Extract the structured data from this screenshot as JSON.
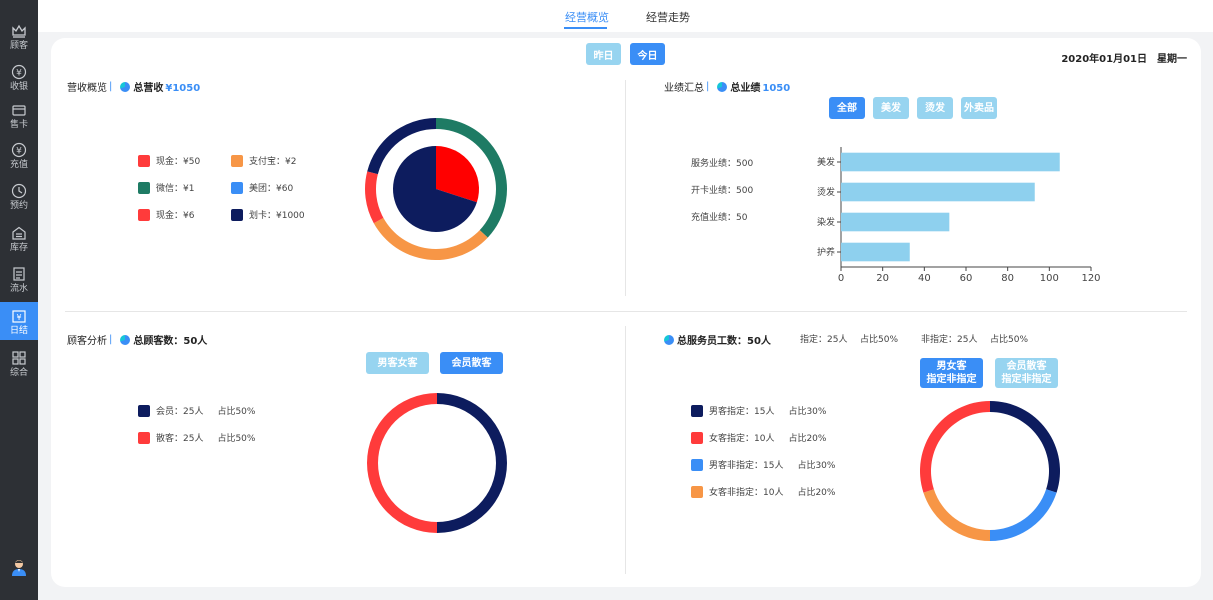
{
  "sidebar": {
    "items": [
      {
        "label": "顾客",
        "icon": "crown-icon"
      },
      {
        "label": "收银",
        "icon": "yen-circle-icon"
      },
      {
        "label": "售卡",
        "icon": "card-icon"
      },
      {
        "label": "充值",
        "icon": "yen-circle-icon"
      },
      {
        "label": "预约",
        "icon": "clock-icon"
      },
      {
        "label": "库存",
        "icon": "warehouse-icon"
      },
      {
        "label": "流水",
        "icon": "list-icon"
      },
      {
        "label": "日结",
        "icon": "calendar-yen-icon"
      },
      {
        "label": "综合",
        "icon": "grid-icon"
      }
    ],
    "active": "日结"
  },
  "tabs": {
    "overview": "经营概览",
    "trend": "经营走势",
    "active": "经营概览"
  },
  "day_buttons": {
    "yesterday": "昨日",
    "today": "今日"
  },
  "date": {
    "date": "2020年01月01日",
    "weekday": "星期一"
  },
  "revenue": {
    "title": "营收概览",
    "sep": "|",
    "total_label": "总营收",
    "total_value": "¥1050",
    "legend": [
      {
        "label": "现金：¥50",
        "color": "#ff3b3b"
      },
      {
        "label": "支付宝：¥2",
        "color": "#f79646"
      },
      {
        "label": "微信：¥1",
        "color": "#1e7b64"
      },
      {
        "label": "美团：¥60",
        "color": "#3a8ef6"
      },
      {
        "label": "现金：¥6",
        "color": "#ff3b3b"
      },
      {
        "label": "划卡：¥1000",
        "color": "#0d1c5e"
      }
    ]
  },
  "performance": {
    "title": "业绩汇总",
    "sep": "|",
    "total_label": "总业绩",
    "total_value": "1050",
    "filters": [
      "全部",
      "美发",
      "烫发",
      "外卖品"
    ],
    "stats": [
      "服务业绩：500",
      "开卡业绩：500",
      "充值业绩：50"
    ]
  },
  "customers": {
    "title": "顾客分析",
    "sep": "|",
    "total_label": "总顾客数：",
    "total_value": "50人",
    "toggle": [
      "男客女客",
      "会员散客"
    ],
    "legend": [
      {
        "label": "会员：25人",
        "pct": "占比50%",
        "color": "#0d1c5e"
      },
      {
        "label": "散客：25人",
        "pct": "占比50%",
        "color": "#ff3b3b"
      }
    ]
  },
  "staff": {
    "total_label": "总服务员工数：",
    "total_value": "50人",
    "designated": "指定：25人",
    "designated_pct": "占比50%",
    "non_designated": "非指定：25人",
    "non_designated_pct": "占比50%",
    "toggle": [
      {
        "line1": "男女客",
        "line2": "指定非指定"
      },
      {
        "line1": "会员散客",
        "line2": "指定非指定"
      }
    ],
    "legend": [
      {
        "label": "男客指定：15人",
        "pct": "占比30%",
        "color": "#0d1c5e"
      },
      {
        "label": "女客指定：10人",
        "pct": "占比20%",
        "color": "#ff3b3b"
      },
      {
        "label": "男客非指定：15人",
        "pct": "占比30%",
        "color": "#3a8ef6"
      },
      {
        "label": "女客非指定：10人",
        "pct": "占比20%",
        "color": "#f79646"
      }
    ]
  },
  "chart_data": [
    {
      "type": "pie",
      "name": "revenue-inner",
      "labels": [
        "现金",
        "划卡"
      ],
      "values": [
        30,
        70
      ],
      "colors": [
        "#ff0000",
        "#0d1c5e"
      ]
    },
    {
      "type": "pie",
      "name": "revenue-ring",
      "labels": [
        "segment-1",
        "segment-2",
        "segment-3",
        "segment-4"
      ],
      "values": [
        37,
        30,
        12,
        21
      ],
      "colors": [
        "#1e7b64",
        "#f79646",
        "#ff3b3b",
        "#0d1c5e"
      ]
    },
    {
      "type": "bar",
      "orientation": "horizontal",
      "categories": [
        "美发",
        "烫发",
        "染发",
        "护养"
      ],
      "values": [
        105,
        93,
        52,
        33
      ],
      "xlim": [
        0,
        120
      ],
      "xticks": [
        0,
        20,
        40,
        60,
        80,
        100,
        120
      ],
      "color": "#8ed0ee"
    },
    {
      "type": "pie",
      "name": "customers",
      "labels": [
        "会员",
        "散客"
      ],
      "values": [
        50,
        50
      ],
      "colors": [
        "#0d1c5e",
        "#ff3b3b"
      ]
    },
    {
      "type": "pie",
      "name": "staff",
      "labels": [
        "男客指定",
        "男客非指定",
        "女客非指定",
        "女客指定"
      ],
      "values": [
        30,
        20,
        20,
        30
      ],
      "colors": [
        "#0d1c5e",
        "#3a8ef6",
        "#f79646",
        "#ff3b3b"
      ]
    }
  ]
}
